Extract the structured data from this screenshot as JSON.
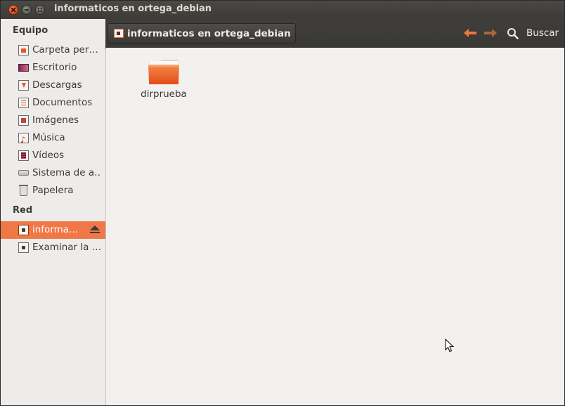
{
  "window": {
    "title": "informaticos en ortega_debian"
  },
  "sidebar": {
    "groups": [
      {
        "heading": "Equipo",
        "items": [
          {
            "label": "Carpeta per…",
            "icon": "home-folder-icon"
          },
          {
            "label": "Escritorio",
            "icon": "desktop-icon"
          },
          {
            "label": "Descargas",
            "icon": "downloads-folder-icon"
          },
          {
            "label": "Documentos",
            "icon": "documents-folder-icon"
          },
          {
            "label": "Imágenes",
            "icon": "pictures-folder-icon"
          },
          {
            "label": "Música",
            "icon": "music-folder-icon"
          },
          {
            "label": "Vídeos",
            "icon": "videos-folder-icon"
          },
          {
            "label": "Sistema de a…",
            "icon": "filesystem-icon"
          },
          {
            "label": "Papelera",
            "icon": "trash-icon"
          }
        ]
      },
      {
        "heading": "Red",
        "items": [
          {
            "label": "informa…",
            "icon": "network-share-icon",
            "selected": true,
            "eject": "eject-icon"
          },
          {
            "label": "Examinar la …",
            "icon": "network-browse-icon"
          }
        ]
      }
    ]
  },
  "toolbar": {
    "location_label": "informaticos en ortega_debian",
    "search_label": "Buscar",
    "back_icon": "arrow-left-icon",
    "forward_icon": "arrow-right-icon"
  },
  "content": {
    "items": [
      {
        "name": "dirprueba",
        "icon": "folder-icon"
      }
    ]
  },
  "colors": {
    "accent": "#f07746",
    "toolbar": "#3c3b37",
    "background": "#f2f1f0"
  }
}
